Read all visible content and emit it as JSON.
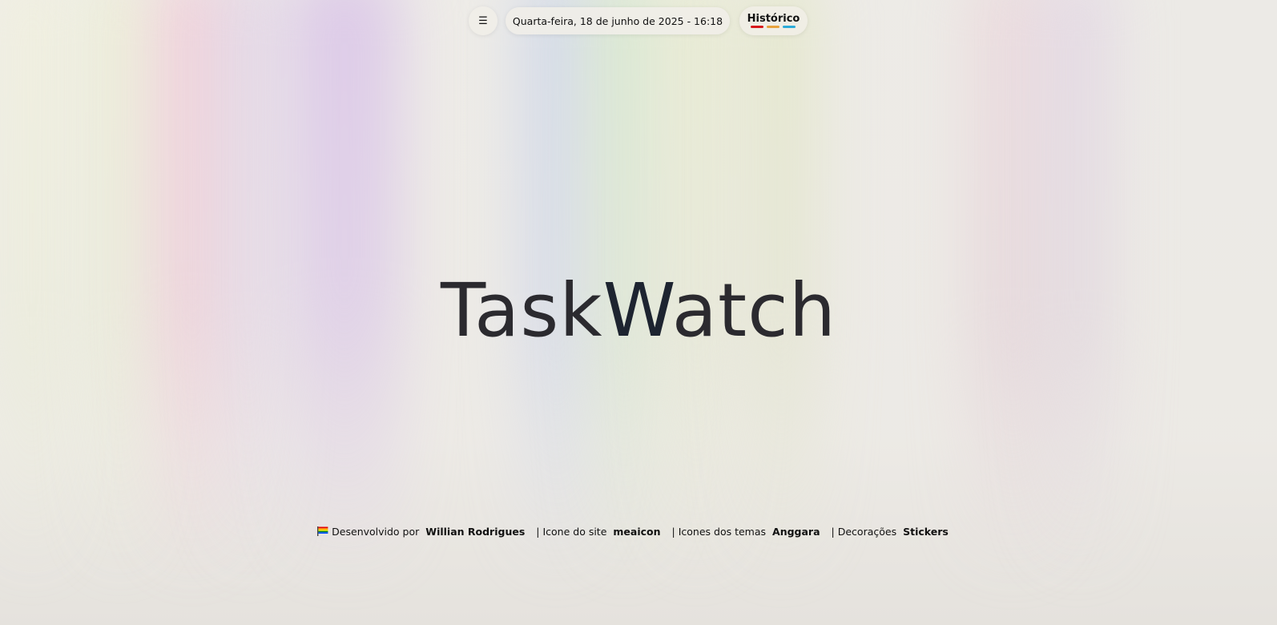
{
  "header": {
    "menu_icon": "☰",
    "date_time": "Quarta-feira, 18 de junho de 2025 - 16:18",
    "history_label": "Histórico",
    "history_bar_colors": [
      "#d7191c",
      "#e8a33d",
      "#2cabd8"
    ]
  },
  "main": {
    "title_part1": "Task",
    "title_part2": "W",
    "title_part3": "atch"
  },
  "footer": {
    "flag_icon": "rainbow-flag-icon",
    "developed_by_label": "Desenvolvido por",
    "developer_name": "Willian Rodrigues",
    "site_icon_label": "| Icone do site",
    "site_icon_author": "meaicon",
    "theme_icons_label": "| Icones dos temas",
    "theme_icons_author": "Anggara",
    "decorations_label": "| Decorações",
    "decorations_author": "Stickers"
  }
}
